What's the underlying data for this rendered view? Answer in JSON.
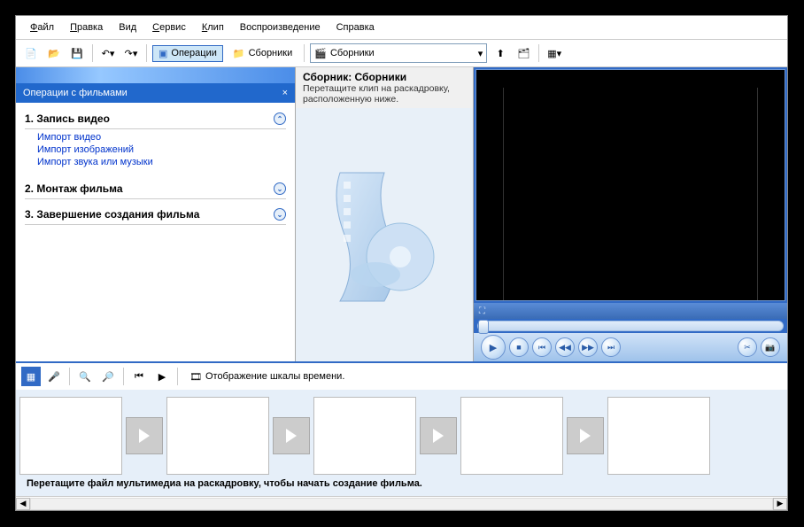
{
  "menu": {
    "file": "Файл",
    "edit": "Правка",
    "view": "Вид",
    "tools": "Сервис",
    "clip": "Клип",
    "play": "Воспроизведение",
    "help": "Справка"
  },
  "toolbar": {
    "operations_label": "Операции",
    "collections_label": "Сборники",
    "location_value": "Сборники"
  },
  "tasks": {
    "panel_title": "Операции с фильмами",
    "close": "×",
    "section1": {
      "title": "1. Запись видео",
      "links": {
        "import_video": "Импорт видео",
        "import_images": "Импорт изображений",
        "import_audio": "Импорт звука или музыки"
      }
    },
    "section2": {
      "title": "2. Монтаж фильма"
    },
    "section3": {
      "title": "3. Завершение создания фильма"
    }
  },
  "collection": {
    "title": "Сборник: Сборники",
    "subtitle": "Перетащите клип на раскадровку, расположенную ниже."
  },
  "timeline": {
    "view_toggle": "Отображение шкалы времени.",
    "hint": "Перетащите файл мультимедиа на раскадровку, чтобы начать создание фильма."
  },
  "icons": {
    "new": "📄",
    "open": "📂",
    "save": "💾",
    "undo": "↶",
    "redo": "↷",
    "folder": "📁",
    "up": "⬆",
    "properties": "🗂",
    "views": "▦"
  }
}
